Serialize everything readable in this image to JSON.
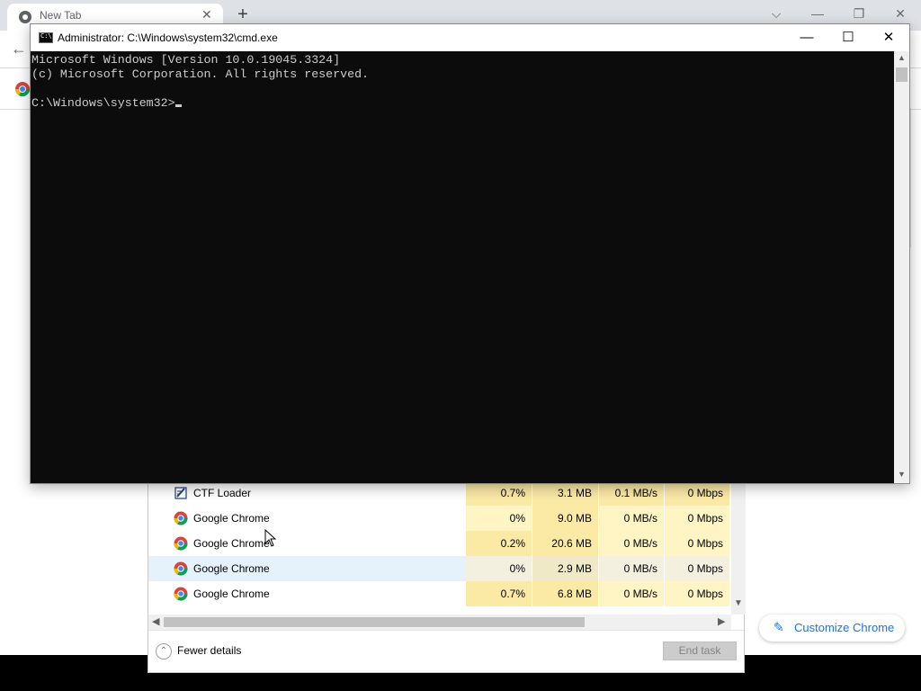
{
  "chrome": {
    "tab_title": "New Tab",
    "tab_close_glyph": "✕",
    "new_tab_glyph": "+",
    "window_controls": {
      "dropdown": "⌵",
      "minimize": "—",
      "restore": "❐",
      "close": "✕"
    },
    "back_glyph": "←",
    "customize_label": "Customize Chrome",
    "customize_icon_glyph": "✎"
  },
  "cmd": {
    "title": "Administrator: C:\\Windows\\system32\\cmd.exe",
    "icon_text": "C:\\",
    "controls": {
      "minimize": "—",
      "maximize": "☐",
      "close": "✕"
    },
    "lines": [
      "Microsoft Windows [Version 10.0.19045.3324]",
      "(c) Microsoft Corporation. All rights reserved.",
      "",
      "C:\\Windows\\system32>"
    ]
  },
  "task_manager": {
    "rows": [
      {
        "name": "CTF Loader",
        "icon": "ctf-loader-icon",
        "cpu": "0.7%",
        "memory": "3.1 MB",
        "disk": "0.1 MB/s",
        "network": "0 Mbps"
      },
      {
        "name": "Google Chrome",
        "icon": "chrome-icon",
        "cpu": "0%",
        "memory": "9.0 MB",
        "disk": "0 MB/s",
        "network": "0 Mbps"
      },
      {
        "name": "Google Chrome",
        "icon": "chrome-icon",
        "cpu": "0.2%",
        "memory": "20.6 MB",
        "disk": "0 MB/s",
        "network": "0 Mbps"
      },
      {
        "name": "Google Chrome",
        "icon": "chrome-icon",
        "cpu": "0%",
        "memory": "2.9 MB",
        "disk": "0 MB/s",
        "network": "0 Mbps",
        "selected": true
      },
      {
        "name": "Google Chrome",
        "icon": "chrome-icon",
        "cpu": "0.7%",
        "memory": "6.8 MB",
        "disk": "0 MB/s",
        "network": "0 Mbps"
      }
    ],
    "fewer_details_label": "Fewer details",
    "fewer_details_glyph": "⌃",
    "end_task_label": "End task"
  },
  "colors": {
    "console_bg": "#0c0c0c",
    "console_text": "#cccccc",
    "heat_low": "#fff4c4",
    "heat_mid": "#fbe9a6",
    "selection": "#e5f1fb",
    "chrome_accent": "#1a73e8"
  }
}
